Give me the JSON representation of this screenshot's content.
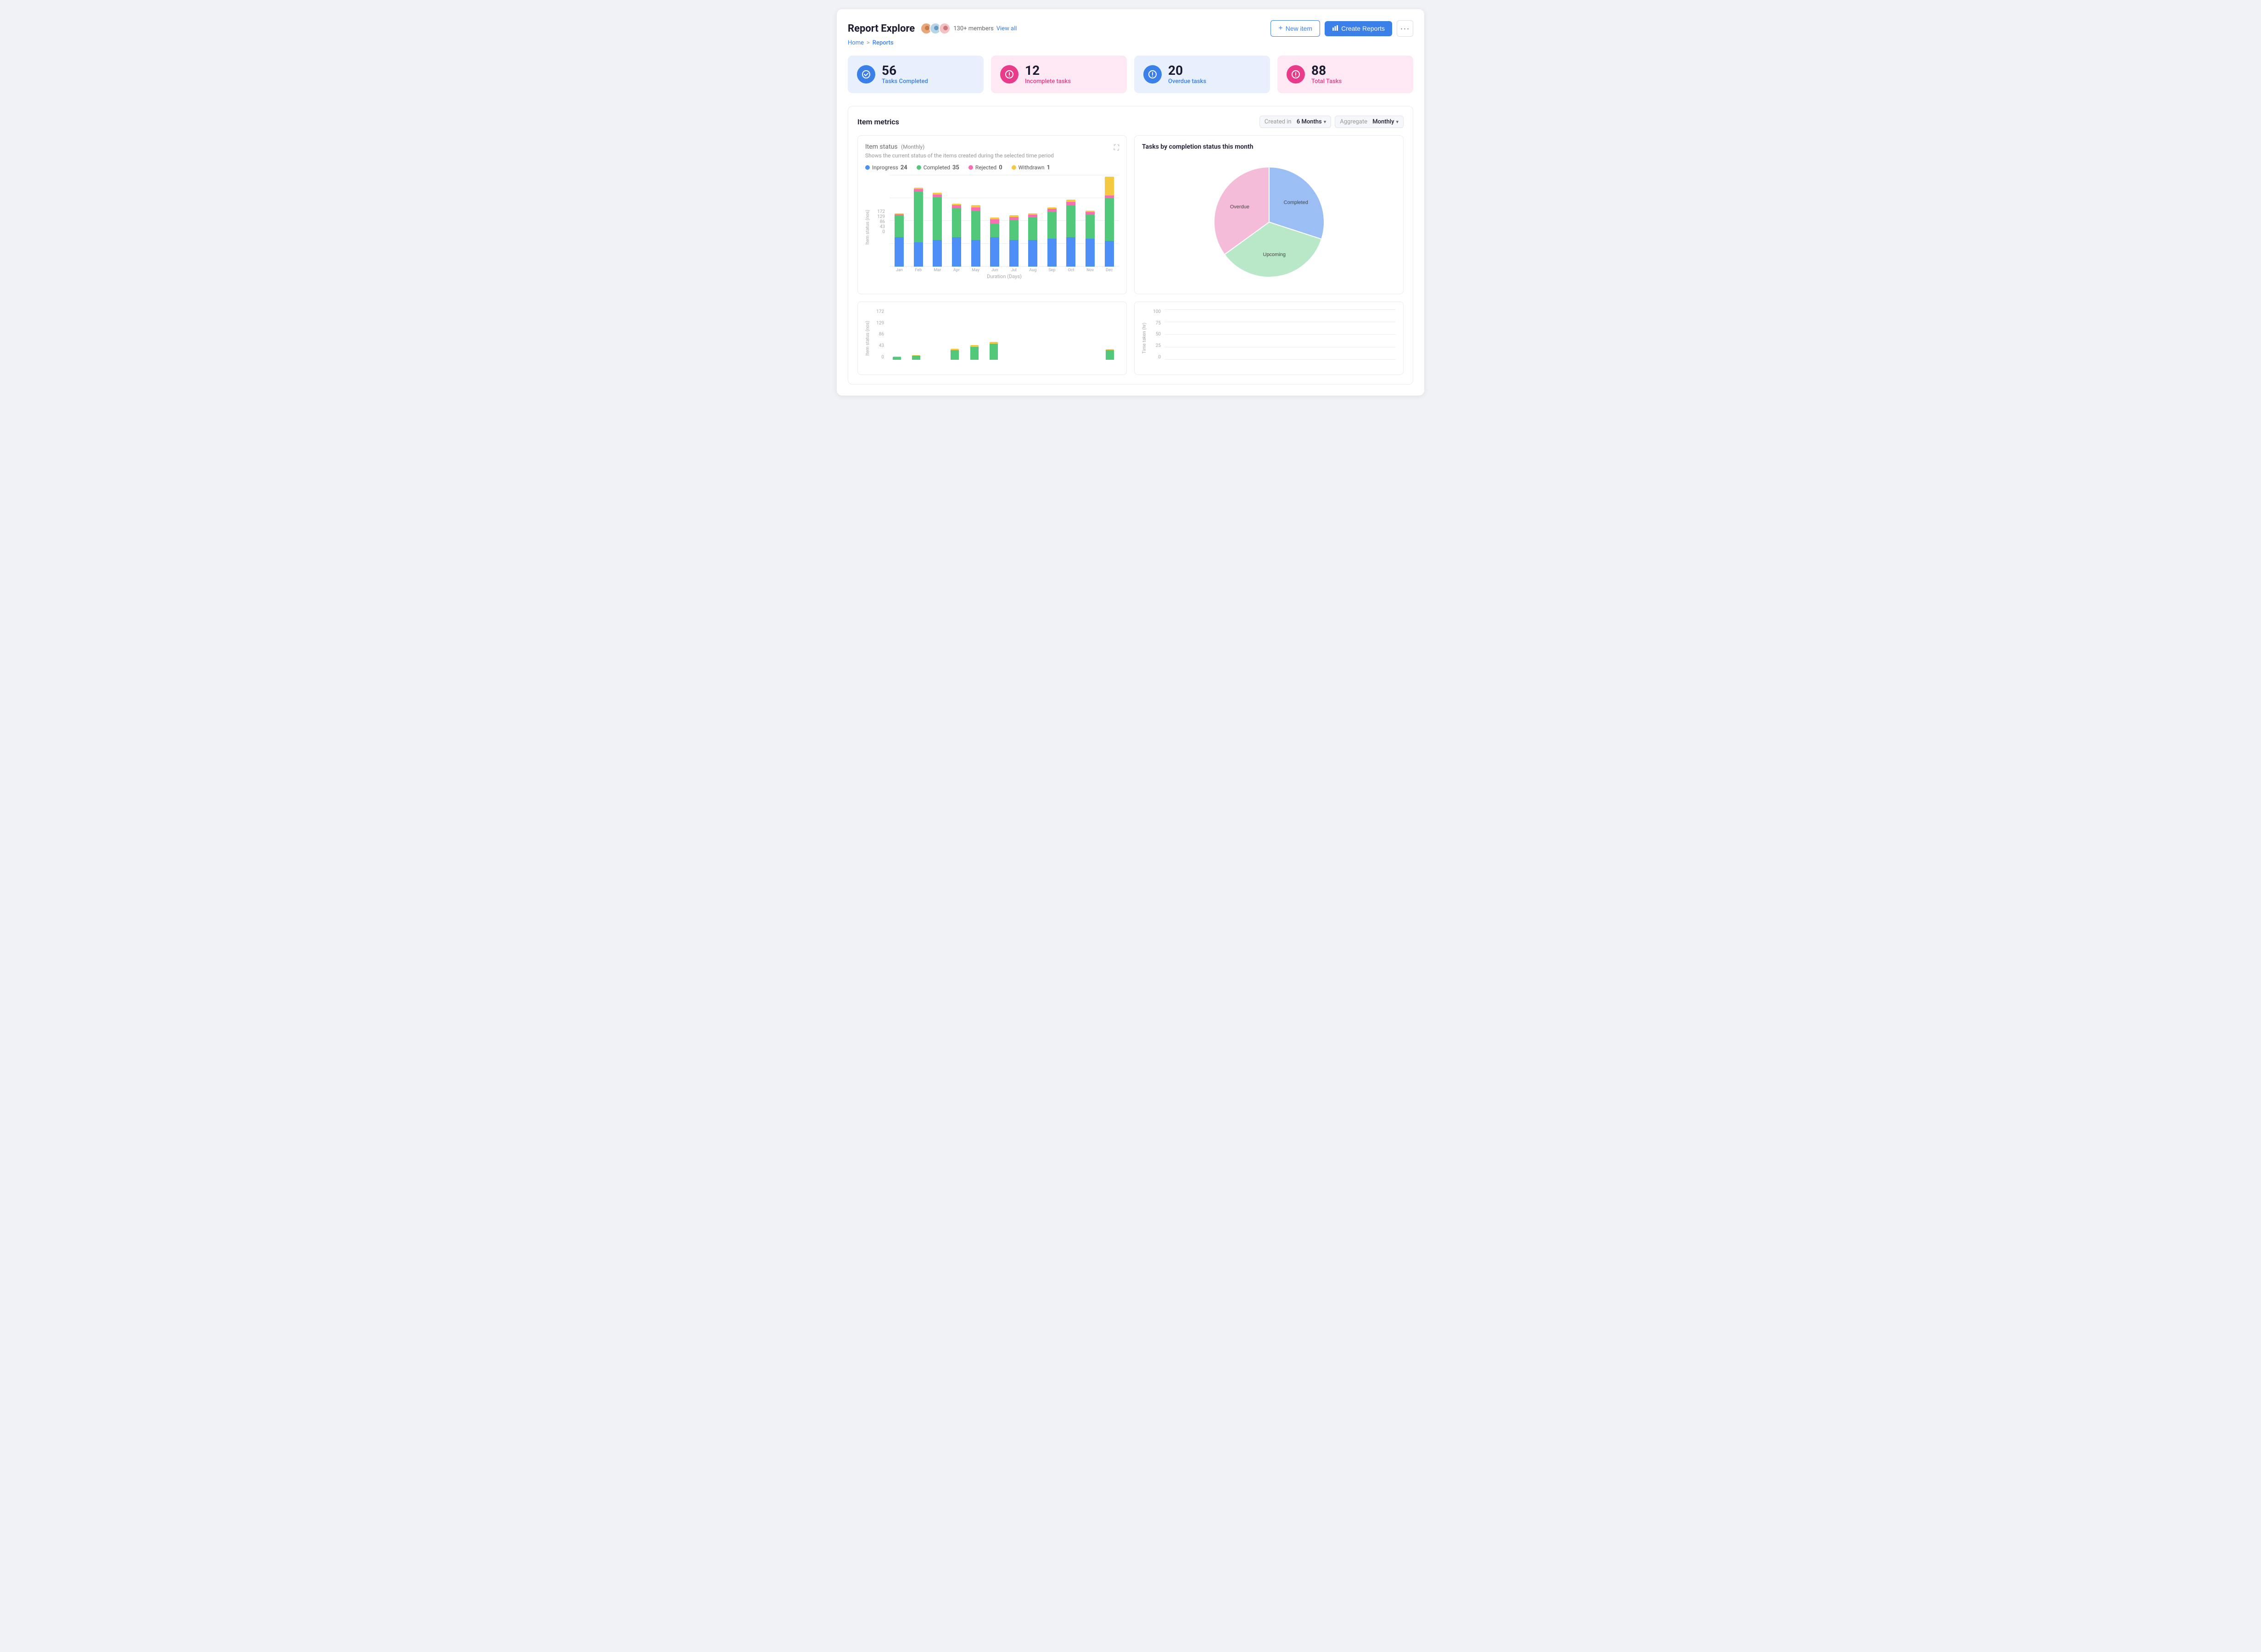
{
  "header": {
    "title": "Report Explore",
    "members_count": "130+ members",
    "view_all": "View all",
    "breadcrumb": {
      "home": "Home",
      "sep": ">",
      "current": "Reports"
    },
    "actions": {
      "new_item": "New item",
      "create_reports": "Create Reports",
      "more_icon": "···"
    }
  },
  "stats": [
    {
      "number": "56",
      "label": "Tasks Completed",
      "color": "blue"
    },
    {
      "number": "12",
      "label": "Incomplete tasks",
      "color": "pink"
    },
    {
      "number": "20",
      "label": "Overdue tasks",
      "color": "blue"
    },
    {
      "number": "88",
      "label": "Total Tasks",
      "color": "pink"
    }
  ],
  "metrics": {
    "title": "Item metrics",
    "controls": {
      "created_label": "Created in",
      "created_value": "6 Months",
      "aggregate_label": "Aggregate",
      "aggregate_value": "Monthly"
    },
    "bar_chart": {
      "title": "Item status",
      "title_sub": "(Monthly)",
      "subtitle": "Shows the current status of the items created during the selected time period",
      "legend": [
        {
          "label": "Inprogress",
          "color": "#4e8ef7",
          "value": "24"
        },
        {
          "label": "Completed",
          "color": "#52c97a",
          "value": "35"
        },
        {
          "label": "Rejected",
          "color": "#f76eb2",
          "value": "0"
        },
        {
          "label": "Withdrawn",
          "color": "#f5c842",
          "value": "1"
        }
      ],
      "y_labels": [
        "172",
        "129",
        "86",
        "43",
        "0"
      ],
      "y_axis_title": "Item status (nos)",
      "x_axis_title": "Duration (Days)",
      "months": [
        "Jan",
        "Feb",
        "Mar",
        "Apr",
        "May",
        "Jun",
        "Jul",
        "Aug",
        "Sep",
        "Oct",
        "Nov",
        "Dec"
      ],
      "bars": [
        {
          "inprogress": 55,
          "completed": 40,
          "rejected": 3,
          "withdrawn": 2
        },
        {
          "inprogress": 45,
          "completed": 95,
          "rejected": 5,
          "withdrawn": 3
        },
        {
          "inprogress": 50,
          "completed": 80,
          "rejected": 5,
          "withdrawn": 3
        },
        {
          "inprogress": 55,
          "completed": 55,
          "rejected": 5,
          "withdrawn": 3
        },
        {
          "inprogress": 50,
          "completed": 55,
          "rejected": 6,
          "withdrawn": 4
        },
        {
          "inprogress": 55,
          "completed": 25,
          "rejected": 8,
          "withdrawn": 4
        },
        {
          "inprogress": 50,
          "completed": 38,
          "rejected": 5,
          "withdrawn": 3
        },
        {
          "inprogress": 50,
          "completed": 42,
          "rejected": 5,
          "withdrawn": 3
        },
        {
          "inprogress": 52,
          "completed": 50,
          "rejected": 6,
          "withdrawn": 3
        },
        {
          "inprogress": 55,
          "completed": 60,
          "rejected": 6,
          "withdrawn": 4
        },
        {
          "inprogress": 52,
          "completed": 45,
          "rejected": 5,
          "withdrawn": 3
        },
        {
          "inprogress": 48,
          "completed": 80,
          "rejected": 5,
          "withdrawn": 35
        }
      ]
    },
    "pie_chart": {
      "title": "Tasks by completion status this month",
      "segments": [
        {
          "label": "Completed",
          "color": "#9bbff4",
          "percent": 30
        },
        {
          "label": "Upcoming",
          "color": "#b8e8c8",
          "percent": 35
        },
        {
          "label": "Overdue",
          "color": "#f5bcd9",
          "percent": 35
        }
      ]
    }
  }
}
